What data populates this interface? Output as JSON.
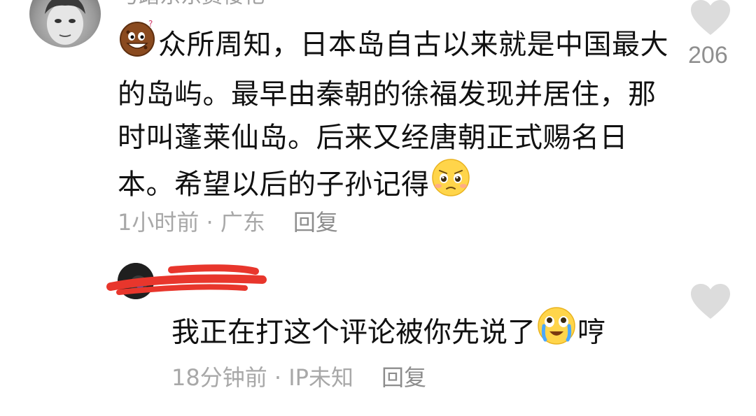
{
  "comment": {
    "username": "弓踏东东费楼祀",
    "text": "众所周知，日本岛自古以来就是中国最大的岛屿。最早由秦朝的徐福发现并居住，那时叫蓬莱仙岛。后来又经唐朝正式赐名日本。希望以后的子孙记得",
    "time": "1小时前 · 广东",
    "reply_label": "回复",
    "like_count": "206",
    "emoji_start": "grinning-cookie-emoji",
    "emoji_end": "pleading-emoji"
  },
  "reply": {
    "text_before_emoji": "我正在打这个评论被你先说了",
    "text_after_emoji": "哼",
    "time": "18分钟前 · IP未知",
    "reply_label": "回复",
    "emoji": "crying-laughing-emoji"
  },
  "colors": {
    "text": "#111111",
    "meta": "#a8a8a8",
    "heart": "#dcdcdc",
    "redact": "#e8362c"
  }
}
